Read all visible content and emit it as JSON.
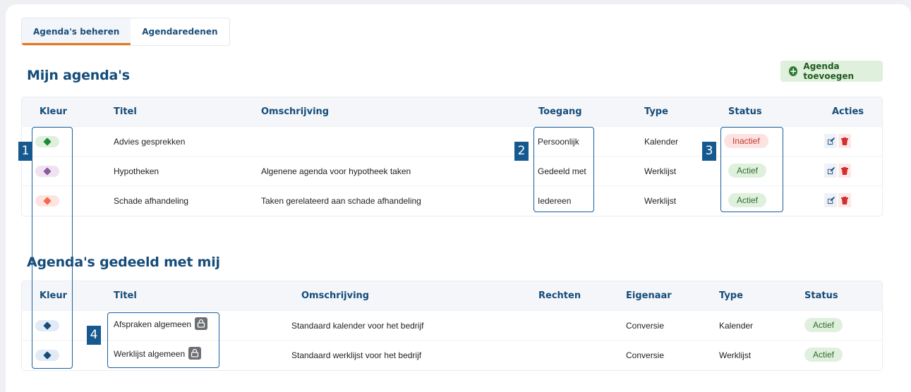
{
  "tabs": [
    {
      "label": "Agenda's beheren",
      "active": true
    },
    {
      "label": "Agendaredenen",
      "active": false
    }
  ],
  "my_agendas": {
    "title": "Mijn agenda's",
    "add_button": "Agenda toevoegen",
    "headers": [
      "Kleur",
      "Titel",
      "Omschrijving",
      "Toegang",
      "Type",
      "Status",
      "Acties"
    ],
    "rows": [
      {
        "color": "#1e8a3a",
        "color_bg": "#dff0dc",
        "title": "Advies gesprekken",
        "description": "",
        "access": "Persoonlijk",
        "type": "Kalender",
        "status": "Inactief"
      },
      {
        "color": "#8e5a9e",
        "color_bg": "#efe3f2",
        "title": "Hypotheken",
        "description": "Algenene agenda voor hypotheek taken",
        "access": "Gedeeld met",
        "type": "Werklijst",
        "status": "Actief"
      },
      {
        "color": "#f26b4f",
        "color_bg": "#fde4de",
        "title": "Schade afhandeling",
        "description": "Taken gerelateerd aan schade afhandeling",
        "access": "Iedereen",
        "type": "Werklijst",
        "status": "Actief"
      }
    ]
  },
  "shared_agendas": {
    "title": "Agenda's gedeeld met mij",
    "headers": [
      "Kleur",
      "Titel",
      "Omschrijving",
      "Rechten",
      "Eigenaar",
      "Type",
      "Status"
    ],
    "rows": [
      {
        "color": "#154c79",
        "color_bg": "#e2ebf5",
        "title": "Afspraken algemeen",
        "description": "Standaard kalender voor het bedrijf",
        "rights": "",
        "owner": "Conversie",
        "type": "Kalender",
        "status": "Actief"
      },
      {
        "color": "#154c79",
        "color_bg": "#e2ebf5",
        "title": "Werklijst algemeen",
        "description": "Standaard werklijst voor het bedrijf",
        "rights": "",
        "owner": "Conversie",
        "type": "Werklijst",
        "status": "Actief"
      }
    ]
  },
  "annotations": [
    "1",
    "2",
    "3",
    "4"
  ],
  "icons": {
    "add": "plus-circle-icon",
    "edit": "edit-icon",
    "delete": "trash-icon",
    "lock": "lock-icon",
    "tag": "tag-icon"
  }
}
